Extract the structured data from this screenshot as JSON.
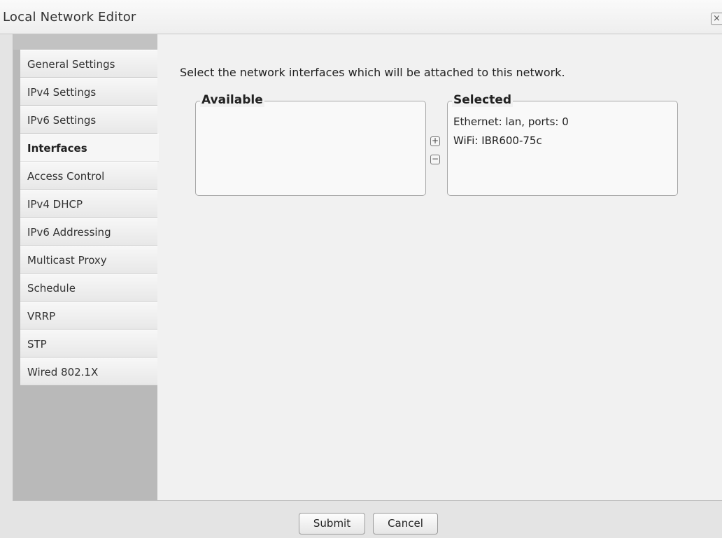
{
  "dialog": {
    "title": "Local Network Editor",
    "close_label": "×"
  },
  "sidebar": {
    "active": "Interfaces",
    "items": [
      {
        "label": "General Settings"
      },
      {
        "label": "IPv4 Settings"
      },
      {
        "label": "IPv6 Settings"
      },
      {
        "label": "Interfaces"
      },
      {
        "label": "Access Control"
      },
      {
        "label": "IPv4 DHCP"
      },
      {
        "label": "IPv6 Addressing"
      },
      {
        "label": "Multicast Proxy"
      },
      {
        "label": "Schedule"
      },
      {
        "label": "VRRP"
      },
      {
        "label": "STP"
      },
      {
        "label": "Wired 802.1X"
      }
    ]
  },
  "main": {
    "instructions": "Select the network interfaces which will be attached to this network.",
    "available": {
      "label": "Available",
      "items": []
    },
    "selected": {
      "label": "Selected",
      "items": [
        {
          "label": "Ethernet: lan, ports: 0"
        },
        {
          "label": "WiFi: IBR600-75c"
        }
      ]
    },
    "add_symbol": "+",
    "remove_symbol": "−"
  },
  "footer": {
    "submit_label": "Submit",
    "cancel_label": "Cancel"
  }
}
